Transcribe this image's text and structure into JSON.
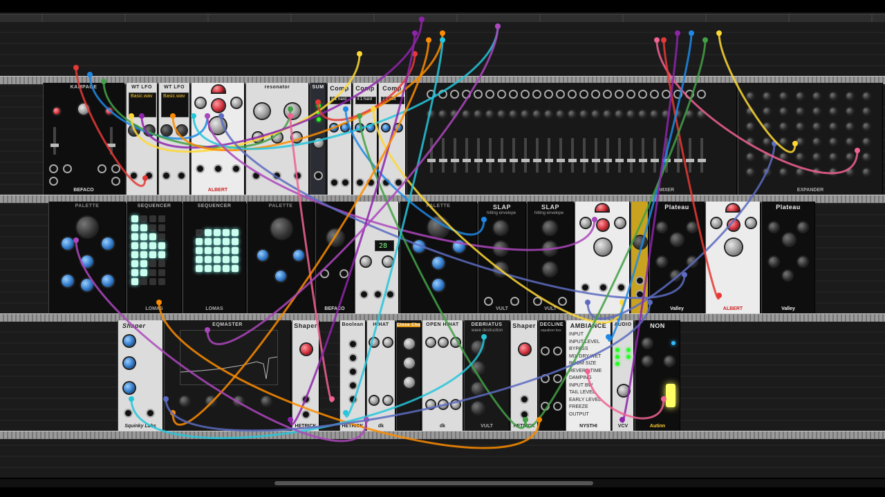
{
  "rows": [
    {
      "id": "row1",
      "modules": [
        {
          "id": "kampage",
          "name": "KAMPAGE",
          "footer": "BEFACO",
          "style": "black"
        },
        {
          "id": "wt-lfo-1",
          "name": "WT LFO",
          "footer": "",
          "style": "light",
          "screen_text": "Basic.wav"
        },
        {
          "id": "wt-lfo-2",
          "name": "WT LFO",
          "footer": "",
          "style": "light",
          "screen_text": "Basic.wav"
        },
        {
          "id": "albert-1",
          "name": "",
          "footer": "ALBERT",
          "style": "white"
        },
        {
          "id": "resonator",
          "name": "resonator",
          "footer": "",
          "style": "light"
        },
        {
          "id": "sum",
          "name": "SUM",
          "footer": "",
          "style": "steel"
        },
        {
          "id": "comp-1",
          "name": "Comp",
          "footer": "",
          "style": "light",
          "mode": "8:1 hard"
        },
        {
          "id": "comp-2",
          "name": "Comp",
          "footer": "",
          "style": "light",
          "mode": "4:1 hard"
        },
        {
          "id": "comp-3",
          "name": "Comp",
          "footer": "",
          "style": "light",
          "mode": "2:1 soft"
        },
        {
          "id": "mixer",
          "name": "MIXER",
          "footer": "",
          "style": "dark"
        },
        {
          "id": "expander",
          "name": "EXPANDER",
          "footer": "",
          "style": "dark"
        }
      ]
    },
    {
      "id": "row2",
      "modules": [
        {
          "id": "palette-1",
          "name": "PALETTE",
          "footer": "",
          "style": "black"
        },
        {
          "id": "sequencer-1",
          "name": "SEQUENCER",
          "footer": "LOMAS",
          "style": "black"
        },
        {
          "id": "sequencer-2",
          "name": "SEQUENCER",
          "footer": "LOMAS",
          "style": "black"
        },
        {
          "id": "palette-2",
          "name": "PALETTE",
          "footer": "",
          "style": "black"
        },
        {
          "id": "bezfaco",
          "name": "",
          "footer": "BEFACO",
          "style": "black"
        },
        {
          "id": "shifter",
          "name": "",
          "footer": "",
          "style": "light",
          "display": "28"
        },
        {
          "id": "palette-3",
          "name": "PALETTE",
          "footer": "",
          "style": "black"
        },
        {
          "id": "slap-1",
          "name": "SLAP",
          "footer": "VULT",
          "style": "black",
          "subtitle": "hitting envelope"
        },
        {
          "id": "slap-2",
          "name": "SLAP",
          "footer": "VULT",
          "style": "black",
          "subtitle": "hitting envelope"
        },
        {
          "id": "albert-2",
          "name": "",
          "footer": "",
          "style": "white"
        },
        {
          "id": "volume",
          "name": "",
          "footer": "",
          "style": "grey"
        },
        {
          "id": "plateau-1",
          "name": "Plateau",
          "footer": "Valley",
          "style": "black"
        },
        {
          "id": "albert-3",
          "name": "",
          "footer": "ALBERT",
          "style": "white"
        },
        {
          "id": "plateau-2",
          "name": "Plateau",
          "footer": "Valley",
          "style": "black"
        }
      ]
    },
    {
      "id": "row3",
      "modules": [
        {
          "id": "shaper-sd",
          "name": "Shaper",
          "footer": "Squinky Labs",
          "style": "light"
        },
        {
          "id": "eqmaster",
          "name": "EQMASTER",
          "footer": "",
          "style": "dark"
        },
        {
          "id": "shaper-1",
          "name": "Shaper",
          "footer": "HETRICK",
          "style": "light"
        },
        {
          "id": "boolean",
          "name": "Boolean",
          "footer": "HETRICK",
          "style": "light"
        },
        {
          "id": "hihat-1",
          "name": "HIHAT",
          "footer": "dk",
          "style": "light"
        },
        {
          "id": "close-choke",
          "name": "Close Choke",
          "footer": "",
          "style": "dark"
        },
        {
          "id": "open-hihat",
          "name": "OPEN HIHAT",
          "footer": "dk",
          "style": "light"
        },
        {
          "id": "debriatus",
          "name": "DEBRIATUS",
          "footer": "VULT",
          "style": "dark",
          "subtitle": "wave destruction"
        },
        {
          "id": "shaper-2",
          "name": "Shaper",
          "footer": "HETRICK",
          "style": "light"
        },
        {
          "id": "decline",
          "name": "DECLINE",
          "footer": "",
          "style": "black",
          "subtitle": "equalizer box"
        },
        {
          "id": "ambiance",
          "name": "AMBIANCE",
          "footer": "NYSTHI",
          "style": "white"
        },
        {
          "id": "audio",
          "name": "AUDIO",
          "footer": "VCV",
          "style": "light"
        },
        {
          "id": "non",
          "name": "NON",
          "footer": "Autinn",
          "style": "black"
        }
      ]
    }
  ],
  "ambiance_params": [
    "INPUT",
    "INPUT LEVEL",
    "BYPASS",
    "MIX DRY-WET",
    "ROOM SIZE",
    "REVERB TIME",
    "DAMPING",
    "INPUT BW",
    "TAIL LEVEL",
    "EARLY LEVEL",
    "FREEZE",
    "OUTPUT"
  ],
  "cable_colors": [
    "#e53935",
    "#1e88e5",
    "#43a047",
    "#fdd835",
    "#8e24aa",
    "#fb8c00",
    "#26c6da",
    "#ab47bc",
    "#5c6bc0",
    "#f06292"
  ],
  "scroll": {
    "position_fraction": 0.31,
    "visible_fraction": 0.36
  }
}
